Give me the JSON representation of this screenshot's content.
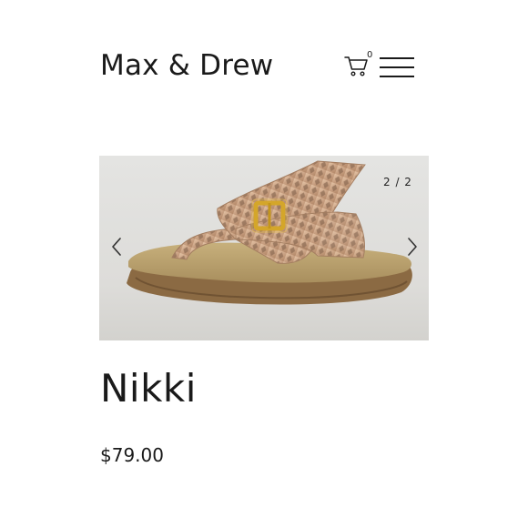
{
  "header": {
    "brand": "Max & Drew",
    "cart_count": "0",
    "cart_icon": "cart-icon",
    "menu_icon": "hamburger-menu-icon"
  },
  "gallery": {
    "counter": "2 / 2",
    "current_index": 2,
    "total": 2,
    "prev_icon": "chevron-left-icon",
    "next_icon": "chevron-right-icon",
    "image_subject": "rose-gold perforated leather thong sandal with gold buckle on cork footbed"
  },
  "product": {
    "title": "Nikki",
    "price": "$79.00"
  },
  "colors": {
    "text": "#1a1a1a",
    "background": "#ffffff",
    "sandal_strap": "#c9a183",
    "buckle": "#d4a62a",
    "footbed": "#b59d6a",
    "sole": "#8b6a43"
  }
}
